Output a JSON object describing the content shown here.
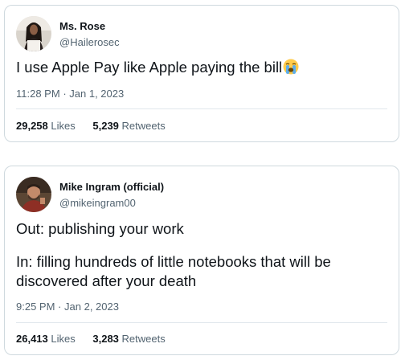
{
  "tweets": [
    {
      "name": "Ms. Rose",
      "handle": "@Hailerosec",
      "text": "I use Apple Pay like Apple paying the bill",
      "emoji_icon": "loudly-crying-face-emoji",
      "time": "11:28 PM",
      "separator": "·",
      "date": "Jan 1, 2023",
      "likes_count": "29,258",
      "likes_label": "Likes",
      "retweets_count": "5,239",
      "retweets_label": "Retweets"
    },
    {
      "name": "Mike Ingram (official)",
      "handle": "@mikeingram00",
      "text_line1": "Out: publishing your work",
      "text_line2": "In: filling hundreds of little notebooks that will be",
      "text_line3": "discovered after your death",
      "time": "9:25 PM",
      "separator": "·",
      "date": "Jan 2, 2023",
      "likes_count": "26,413",
      "likes_label": "Likes",
      "retweets_count": "3,283",
      "retweets_label": "Retweets"
    }
  ],
  "colors": {
    "text": "#0f1419",
    "secondary": "#536471",
    "border": "#cfd9de"
  }
}
